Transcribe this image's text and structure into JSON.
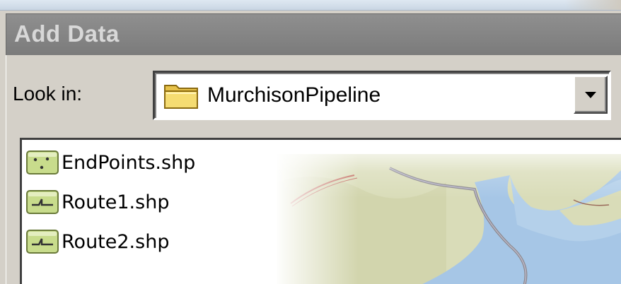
{
  "dialog": {
    "title": "Add Data",
    "look_in_label": "Look in:",
    "location": {
      "value": "MurchisonPipeline",
      "icon": "folder-icon"
    },
    "files": [
      {
        "name": "EndPoints.shp",
        "icon": "point-shapefile-icon"
      },
      {
        "name": "Route1.shp",
        "icon": "line-shapefile-icon"
      },
      {
        "name": "Route2.shp",
        "icon": "line-shapefile-icon"
      }
    ]
  },
  "colors": {
    "title_bar": "#858585",
    "title_text": "#d8d8d8",
    "dialog_bg": "#d4d0c8",
    "folder_yellow": "#f2d666",
    "shapefile_green": "#c8dc8c",
    "water_blue": "#a6c6e6",
    "land_tan": "#d9dcb8"
  }
}
